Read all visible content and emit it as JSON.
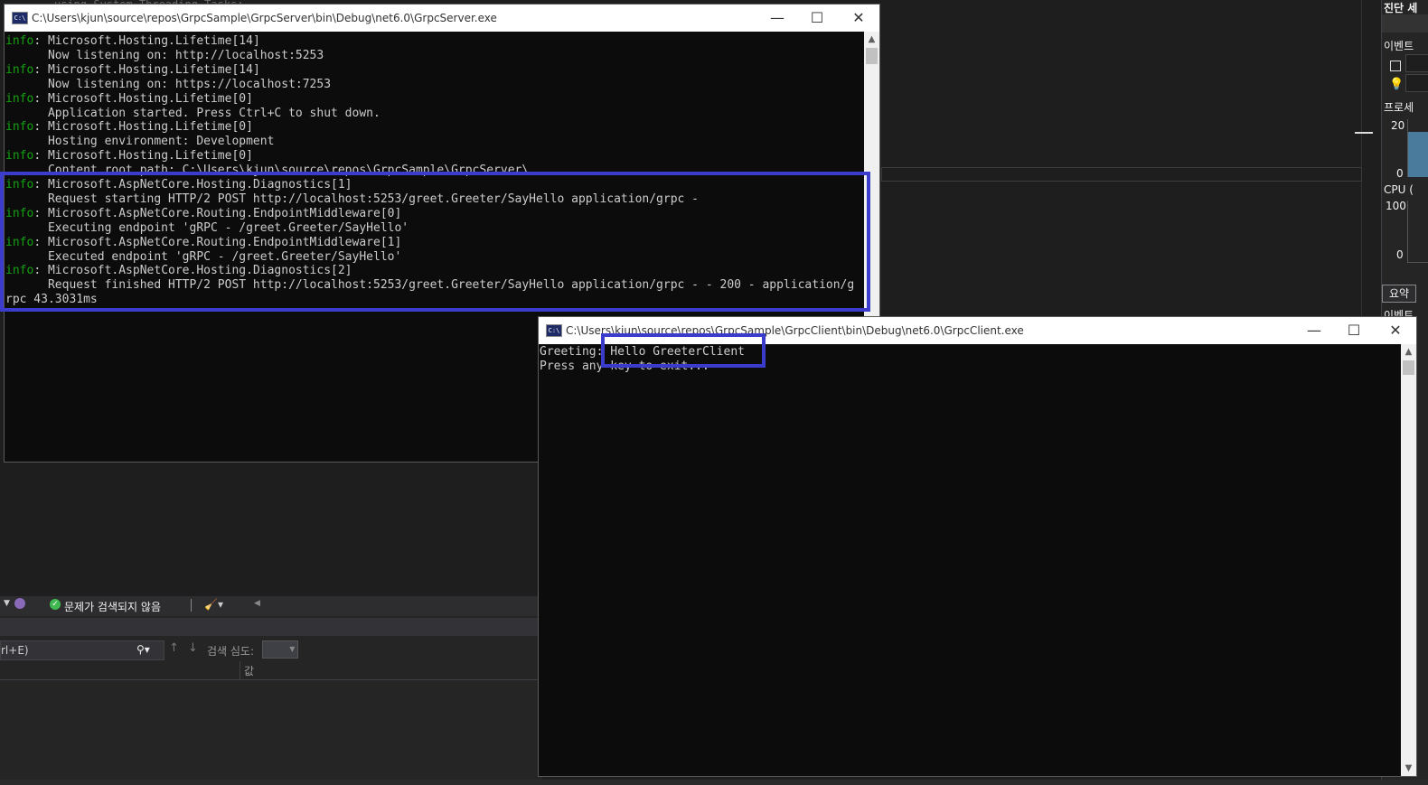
{
  "server_window": {
    "title": "C:\\Users\\kjun\\source\\repos\\GrpcSample\\GrpcServer\\bin\\Debug\\net6.0\\GrpcServer.exe",
    "lines": [
      {
        "prefix": "info",
        "text": ": Microsoft.Hosting.Lifetime[14]"
      },
      {
        "prefix": "",
        "text": "      Now listening on: http://localhost:5253"
      },
      {
        "prefix": "info",
        "text": ": Microsoft.Hosting.Lifetime[14]"
      },
      {
        "prefix": "",
        "text": "      Now listening on: https://localhost:7253"
      },
      {
        "prefix": "info",
        "text": ": Microsoft.Hosting.Lifetime[0]"
      },
      {
        "prefix": "",
        "text": "      Application started. Press Ctrl+C to shut down."
      },
      {
        "prefix": "info",
        "text": ": Microsoft.Hosting.Lifetime[0]"
      },
      {
        "prefix": "",
        "text": "      Hosting environment: Development"
      },
      {
        "prefix": "info",
        "text": ": Microsoft.Hosting.Lifetime[0]"
      },
      {
        "prefix": "",
        "text": "      Content root path: C:\\Users\\kjun\\source\\repos\\GrpcSample\\GrpcServer\\"
      },
      {
        "prefix": "info",
        "text": ": Microsoft.AspNetCore.Hosting.Diagnostics[1]"
      },
      {
        "prefix": "",
        "text": "      Request starting HTTP/2 POST http://localhost:5253/greet.Greeter/SayHello application/grpc -"
      },
      {
        "prefix": "info",
        "text": ": Microsoft.AspNetCore.Routing.EndpointMiddleware[0]"
      },
      {
        "prefix": "",
        "text": "      Executing endpoint 'gRPC - /greet.Greeter/SayHello'"
      },
      {
        "prefix": "info",
        "text": ": Microsoft.AspNetCore.Routing.EndpointMiddleware[1]"
      },
      {
        "prefix": "",
        "text": "      Executed endpoint 'gRPC - /greet.Greeter/SayHello'"
      },
      {
        "prefix": "info",
        "text": ": Microsoft.AspNetCore.Hosting.Diagnostics[2]"
      },
      {
        "prefix": "",
        "text": "      Request finished HTTP/2 POST http://localhost:5253/greet.Greeter/SayHello application/grpc - - 200 - application/g"
      },
      {
        "prefix": "",
        "text": "rpc 43.3031ms"
      }
    ]
  },
  "client_window": {
    "title": "C:\\Users\\kjun\\source\\repos\\GrpcSample\\GrpcClient\\bin\\Debug\\net6.0\\GrpcClient.exe",
    "lines": [
      {
        "text": "Greeting: Hello GreeterClient"
      },
      {
        "text": "Press any key to exit..."
      }
    ]
  },
  "window_buttons": {
    "minimize": "—",
    "maximize": "☐",
    "close": "✕"
  },
  "vs": {
    "right_panel": {
      "header": "진단 세",
      "events": "이벤트",
      "process": "프로세",
      "cpu": "CPU (",
      "summary_tab": "요약",
      "events2": "이벤트",
      "mem_max": "20",
      "mem_min": "0",
      "cpu_max": "100",
      "cpu_min": "0"
    },
    "toolbar": {
      "issues": "문제가 검색되지 않음"
    },
    "search": {
      "placeholder_fragment": "rl+E)",
      "depth_label": "검색 심도:"
    },
    "table": {
      "value_header": "값"
    },
    "code_fragment": "using System.Threading.Tasks;"
  },
  "colors": {
    "highlight": "#3b3bcc",
    "info_green": "#13a10e",
    "console_bg": "#0c0c0c"
  }
}
